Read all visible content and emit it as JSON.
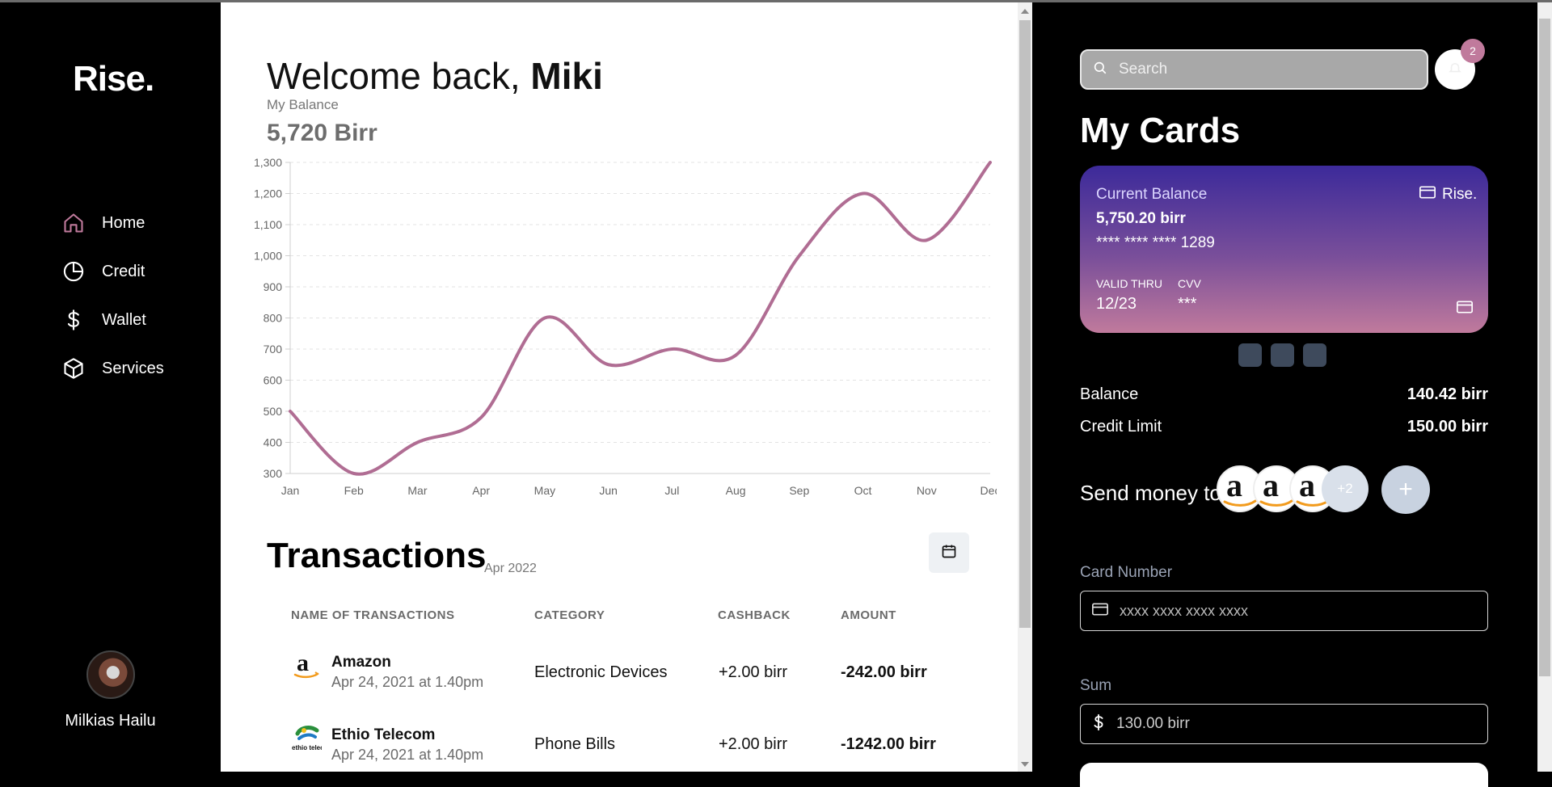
{
  "sidebar": {
    "logo": "Rise.",
    "nav": [
      {
        "label": "Home",
        "icon": "home-icon"
      },
      {
        "label": "Credit",
        "icon": "pie-chart-icon"
      },
      {
        "label": "Wallet",
        "icon": "dollar-icon"
      },
      {
        "label": "Services",
        "icon": "box-icon"
      }
    ],
    "user_name": "Milkias Hailu"
  },
  "main": {
    "welcome_prefix": "Welcome back,",
    "welcome_name": "Miki",
    "balance_label": "My Balance",
    "balance_value": "5,720 Birr",
    "transactions_title": "Transactions",
    "transactions_date": "Apr 2022",
    "columns": [
      "NAME OF TRANSACTIONS",
      "CATEGORY",
      "CASHBACK",
      "AMOUNT"
    ],
    "transactions": [
      {
        "name": "Amazon",
        "time": "Apr 24, 2021 at 1.40pm",
        "category": "Electronic Devices",
        "cashback": "+2.00 birr",
        "amount": "-242.00 birr",
        "logo": "amazon-logo-icon"
      },
      {
        "name": "Ethio Telecom",
        "time": "Apr 24, 2021 at 1.40pm",
        "category": "Phone Bills",
        "cashback": "+2.00 birr",
        "amount": "-1242.00 birr",
        "logo": "ethio-telecom-logo-icon"
      }
    ]
  },
  "chart_data": {
    "type": "line",
    "categories": [
      "Jan",
      "Feb",
      "Mar",
      "Apr",
      "May",
      "Jun",
      "Jul",
      "Aug",
      "Sep",
      "Oct",
      "Nov",
      "Dec"
    ],
    "series": [
      {
        "values": [
          500,
          300,
          400,
          480,
          800,
          650,
          700,
          680,
          1000,
          1200,
          1050,
          1300
        ],
        "color": "#b06d93"
      }
    ],
    "ylim": [
      300,
      1300
    ],
    "yticks": [
      300,
      400,
      500,
      600,
      700,
      800,
      900,
      1000,
      1100,
      1200,
      1300
    ],
    "ytick_labels": [
      "300",
      "400",
      "500",
      "600",
      "700",
      "800",
      "900",
      "1,000",
      "1,100",
      "1,200",
      "1,300"
    ],
    "grid": true
  },
  "right": {
    "search_placeholder": "Search",
    "notification_count": "2",
    "title": "My Cards",
    "card": {
      "current_balance_label": "Current Balance",
      "amount": "5,750.20 birr",
      "number": "**** **** **** 1289",
      "brand": "Rise.",
      "valid_thru_label": "VALID THRU",
      "valid_thru": "12/23",
      "cvv_label": "CVV",
      "cvv": "***"
    },
    "balance_label": "Balance",
    "balance_value": "140.42 birr",
    "credit_limit_label": "Credit Limit",
    "credit_limit_value": "150.00 birr",
    "send_money_label": "Send money to",
    "recipients_more": "+2",
    "add_symbol": "+",
    "card_number_label": "Card Number",
    "card_number_placeholder": "xxxx xxxx xxxx xxxx",
    "sum_label": "Sum",
    "sum_value": "130.00 birr",
    "accent_color": "#c07a9c"
  }
}
